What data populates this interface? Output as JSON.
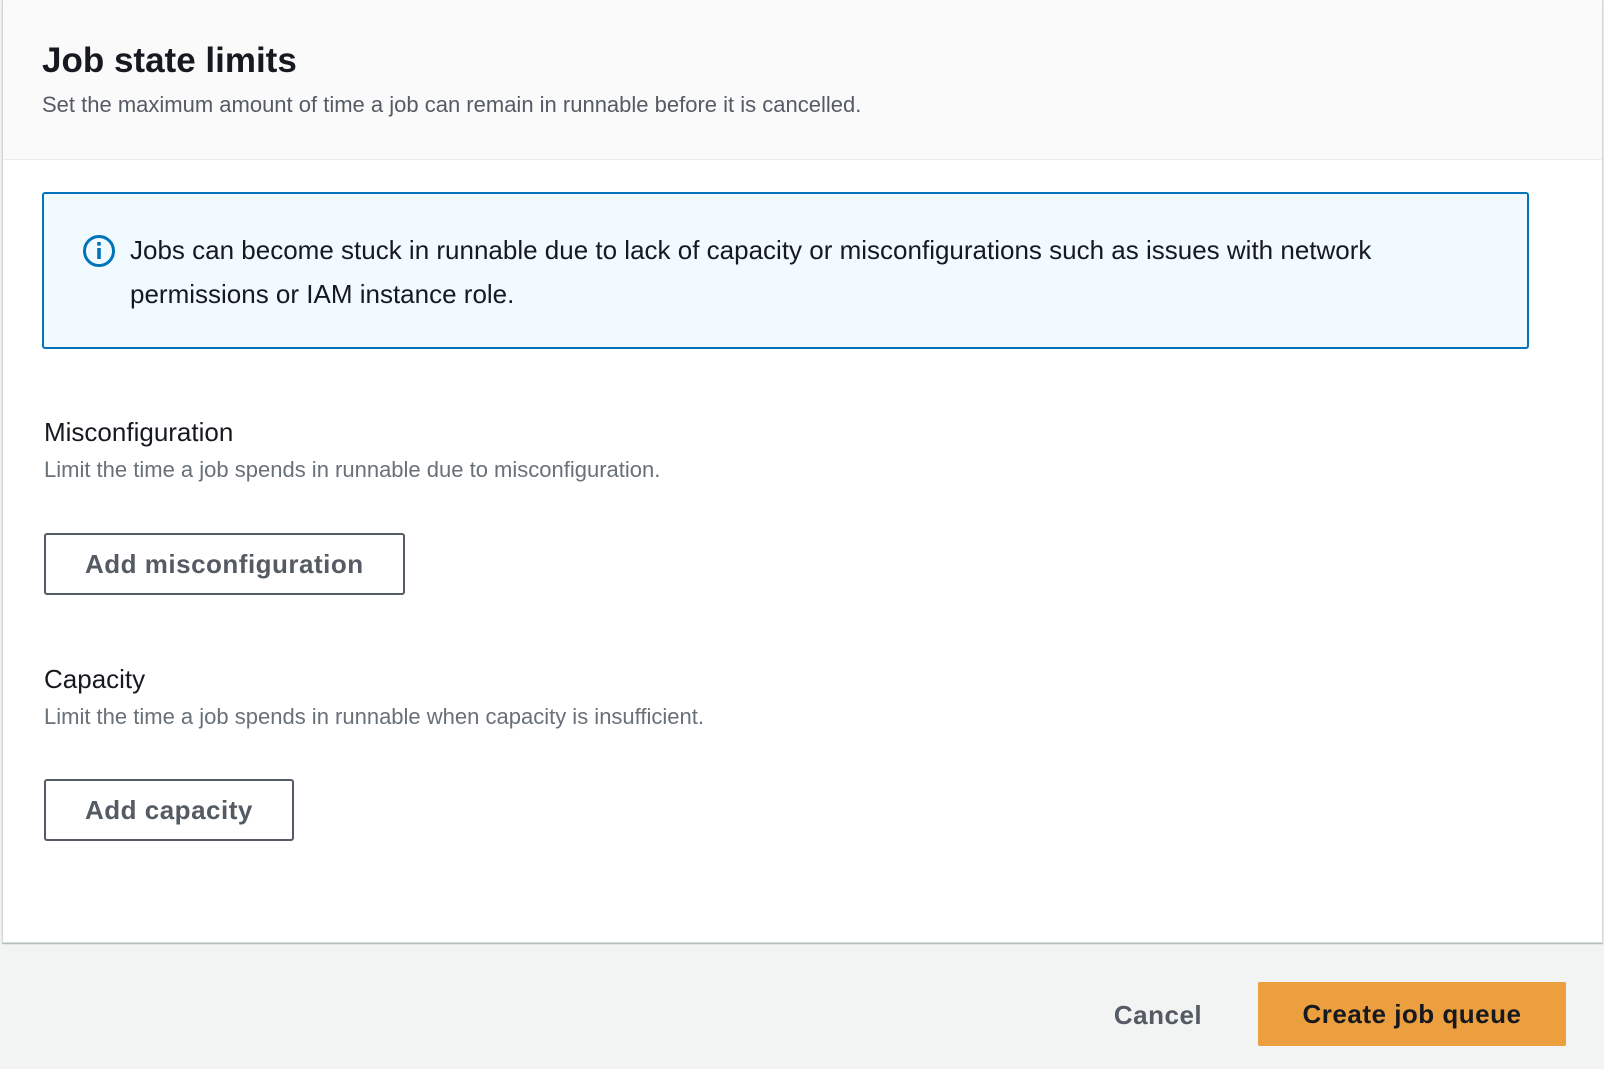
{
  "panel": {
    "title": "Job state limits",
    "description": "Set the maximum amount of time a job can remain in runnable before it is cancelled."
  },
  "info_alert": {
    "icon": "info-icon",
    "text": "Jobs can become stuck in runnable due to lack of capacity or misconfigurations such as issues with network permissions or IAM instance role."
  },
  "misconfiguration": {
    "label": "Misconfiguration",
    "description": "Limit the time a job spends in runnable due to misconfiguration.",
    "button_label": "Add misconfiguration"
  },
  "capacity": {
    "label": "Capacity",
    "description": "Limit the time a job spends in runnable when capacity is insufficient.",
    "button_label": "Add capacity"
  },
  "footer": {
    "cancel_label": "Cancel",
    "submit_label": "Create job queue"
  },
  "colors": {
    "primary_button": "#ec9f3f",
    "info_border": "#0073bb",
    "info_background": "#f1faff"
  }
}
